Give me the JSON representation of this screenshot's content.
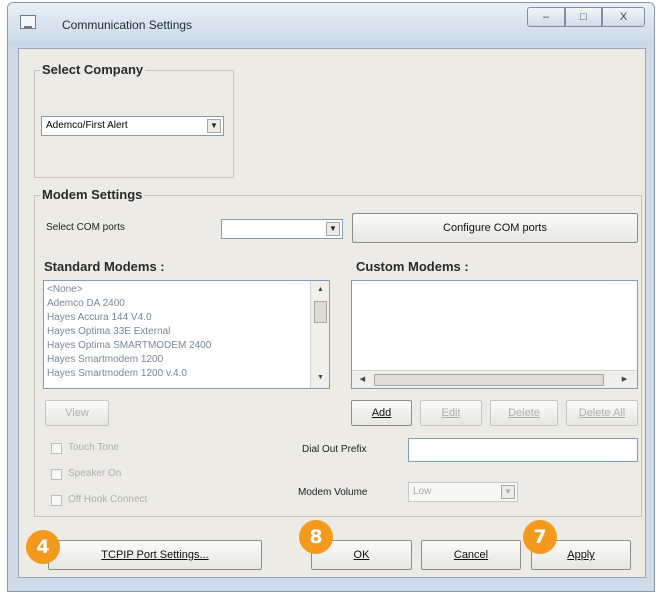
{
  "window": {
    "title": "Communication Settings",
    "controls": {
      "minimize": "–",
      "maximize": "□",
      "close": "X"
    }
  },
  "select_company": {
    "title": "Select Company",
    "company": "Ademco/First Alert"
  },
  "modem_settings": {
    "title": "Modem Settings",
    "com_label": "Select COM ports",
    "com_value": "",
    "configure_button": "Configure COM ports",
    "standard_title": "Standard Modems :",
    "standard_items": [
      "<None>",
      "Ademco DA 2400",
      "Hayes Accura 144 V4.0",
      "Hayes Optima 33E External",
      "Hayes Optima SMARTMODEM 2400",
      "Hayes Smartmodem 1200",
      "Hayes Smartmodem 1200 v.4.0"
    ],
    "custom_title": "Custom Modems :",
    "custom_items": [],
    "view_button": "View",
    "add_button": "Add",
    "edit_button": "Edit",
    "delete_button": "Delete",
    "delete_all_button": "Delete All",
    "touch_tone_label": "Touch Tone",
    "speaker_on_label": "Speaker On",
    "off_hook_label": "Off Hook Connect",
    "dial_prefix_label": "Dial Out Prefix",
    "dial_prefix_value": "",
    "modem_volume_label": "Modem Volume",
    "modem_volume_value": "Low"
  },
  "buttons": {
    "tcpip": "TCPIP Port Settings...",
    "ok": "OK",
    "cancel": "Cancel",
    "apply": "Apply"
  },
  "badges": {
    "tcpip": "4",
    "ok": "8",
    "apply": "7"
  },
  "colors": {
    "badge": "#f39a1c",
    "window_frame": "#cfdbe8"
  }
}
